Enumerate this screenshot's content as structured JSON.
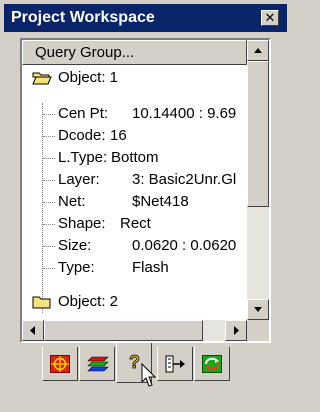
{
  "window": {
    "title": "Project Workspace",
    "close_glyph": "✕"
  },
  "tree": {
    "header": "Query Group...",
    "object1_label": "Object: 1",
    "properties": [
      {
        "label": "Cen Pt:",
        "value": "10.14400 : 9.69"
      },
      {
        "label": "Dcode:",
        "value": "16"
      },
      {
        "label": "L.Type:",
        "value": "Bottom"
      },
      {
        "label": "Layer:",
        "value": "3: Basic2Unr.Gl"
      },
      {
        "label": "Net:",
        "value": "$Net418"
      },
      {
        "label": "Shape:",
        "value": "Rect"
      },
      {
        "label": "Size:",
        "value": "0.0620 : 0.0620"
      },
      {
        "label": "Type:",
        "value": "Flash"
      }
    ],
    "object2_label": "Object: 2"
  },
  "tabs": [
    {
      "icon": "crosshair-target-icon"
    },
    {
      "icon": "layers-icon"
    },
    {
      "icon": "query-icon"
    },
    {
      "icon": "netlist-icon"
    },
    {
      "icon": "refresh-icon"
    }
  ],
  "colors": {
    "titlebar": "#0a246a",
    "face": "#d4d0c8",
    "folder": "#f5e27a"
  }
}
